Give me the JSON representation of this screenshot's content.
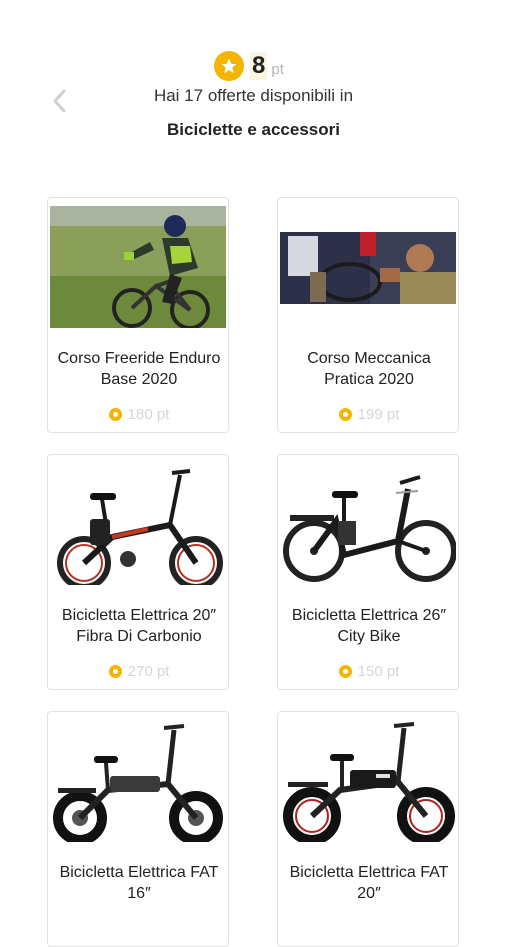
{
  "header": {
    "points_value": "8",
    "points_unit": "pt",
    "subtitle": "Hai 17 offerte disponibili in",
    "category": "Biciclette e accessori",
    "accent_color": "#f4b400"
  },
  "offers": [
    {
      "title_line1": "Corso Freeride Enduro",
      "title_line2": "Base 2020",
      "price": "180 pt",
      "image": "mountain-bike-rider-photo"
    },
    {
      "title_line1": "Corso Meccanica",
      "title_line2": "Pratica 2020",
      "price": "199 pt",
      "image": "bike-mechanic-workshop-photo"
    },
    {
      "title_line1": "Bicicletta Elettrica 20″",
      "title_line2": "Fibra Di Carbonio",
      "price": "270 pt",
      "image": "folding-ebike-red-photo"
    },
    {
      "title_line1": "Bicicletta Elettrica 26″",
      "title_line2": "City Bike",
      "price": "150 pt",
      "image": "city-ebike-photo"
    },
    {
      "title_line1": "Bicicletta Elettrica FAT",
      "title_line2": "16″",
      "price": "",
      "image": "fat-ebike-16-photo"
    },
    {
      "title_line1": "Bicicletta Elettrica FAT",
      "title_line2": "20″",
      "price": "",
      "image": "fat-ebike-20-photo"
    }
  ]
}
